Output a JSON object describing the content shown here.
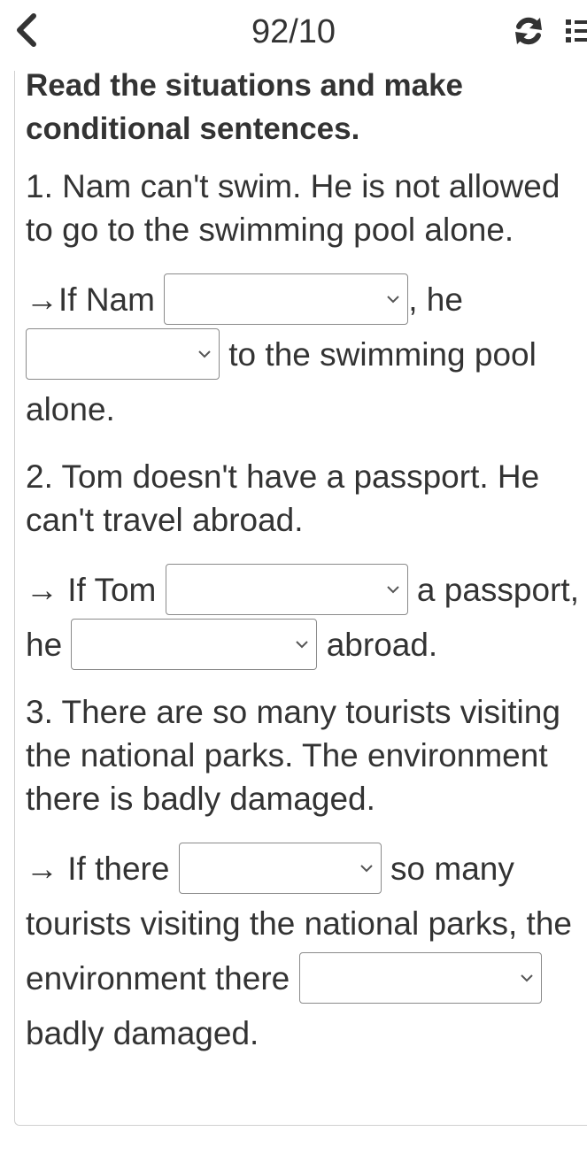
{
  "header": {
    "page_counter": "92/10",
    "back_icon": "chevron-left-icon",
    "refresh_icon": "refresh-icon",
    "list_icon": "list-icon"
  },
  "exercise": {
    "instruction": "Read the situations and make conditional sentences.",
    "items": [
      {
        "situation": "1. Nam can't swim. He is not allowed to go to the swimming pool alone.",
        "parts": [
          "→If Nam",
          ", he",
          "to the swimming pool alone."
        ]
      },
      {
        "situation": "2. Tom doesn't have a passport. He can't travel abroad.",
        "parts": [
          "→ If Tom",
          "a passport, he",
          "abroad."
        ]
      },
      {
        "situation": "3. There are so many tourists visiting the national parks. The environment there is badly damaged.",
        "parts": [
          "→ If there",
          "so many tourists visiting the national parks, the environment there",
          "badly damaged."
        ]
      }
    ],
    "dropdown_values": [
      "",
      "",
      "",
      "",
      "",
      ""
    ]
  },
  "colors": {
    "text": "#333333",
    "border": "#8a8a8a",
    "card_border": "#cfcfcf"
  }
}
